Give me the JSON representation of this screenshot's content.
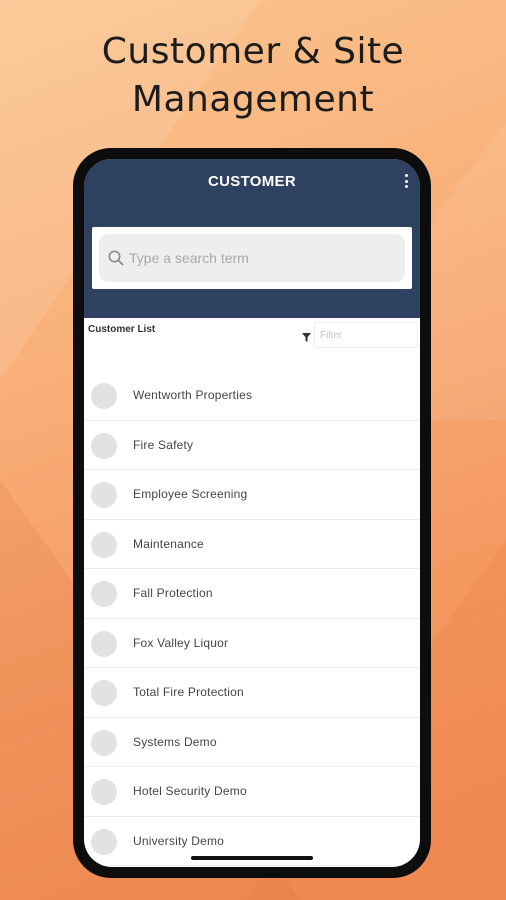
{
  "promo": {
    "headline_line1": "Customer & Site",
    "headline_line2": "Management"
  },
  "appbar": {
    "title": "CUSTOMER",
    "menu_icon": "more-vert-icon",
    "color": "#2f4160"
  },
  "search": {
    "placeholder": "Type a search term",
    "icon": "search-icon"
  },
  "list": {
    "title": "Customer List",
    "filter_placeholder": "Filter",
    "filter_icon": "funnel-icon"
  },
  "customers": [
    {
      "name": "Wentworth Properties"
    },
    {
      "name": "Fire Safety"
    },
    {
      "name": "Employee Screening"
    },
    {
      "name": "Maintenance"
    },
    {
      "name": "Fall Protection"
    },
    {
      "name": "Fox Valley Liquor"
    },
    {
      "name": "Total Fire Protection"
    },
    {
      "name": "Systems Demo"
    },
    {
      "name": "Hotel Security Demo"
    },
    {
      "name": "University Demo"
    }
  ]
}
